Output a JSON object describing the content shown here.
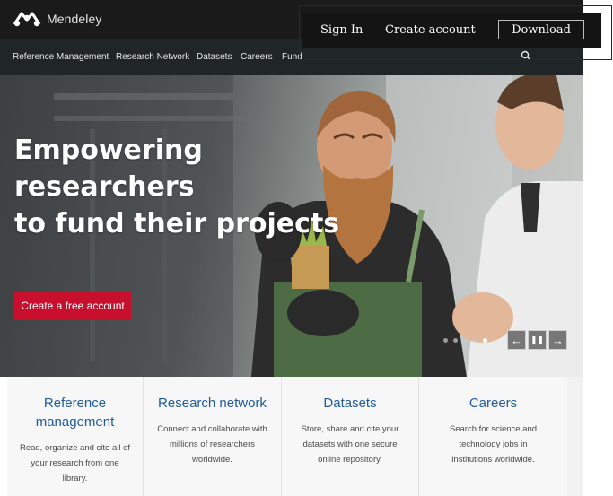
{
  "brand": {
    "name": "Mendeley"
  },
  "auth": {
    "sign_in": "Sign In",
    "create_account": "Create account",
    "download": "Download"
  },
  "nav": {
    "items": [
      {
        "label": "Reference Management"
      },
      {
        "label": "Research Network"
      },
      {
        "label": "Datasets"
      },
      {
        "label": "Careers"
      },
      {
        "label": "Fund"
      }
    ],
    "search_icon": "search-icon"
  },
  "hero": {
    "title_line1": "Empowering researchers",
    "title_line2": "to fund their projects",
    "cta_label": "Create a free account",
    "slide_count": 5,
    "active_slide": 5,
    "controls": {
      "prev": "←",
      "pause": "❚❚",
      "next": "→"
    }
  },
  "cards": [
    {
      "title": "Reference management",
      "description": "Read, organize and cite all of your research from one library."
    },
    {
      "title": "Research network",
      "description": "Connect and collaborate with millions of researchers worldwide."
    },
    {
      "title": "Datasets",
      "description": "Store, share and cite your datasets with one secure online repository."
    },
    {
      "title": "Careers",
      "description": "Search for science and technology jobs in institutions worldwide."
    }
  ],
  "colors": {
    "brand_red": "#c8102e",
    "link_blue": "#1e5b9c",
    "topbar": "#1a1a1a",
    "nav": "#202528"
  }
}
